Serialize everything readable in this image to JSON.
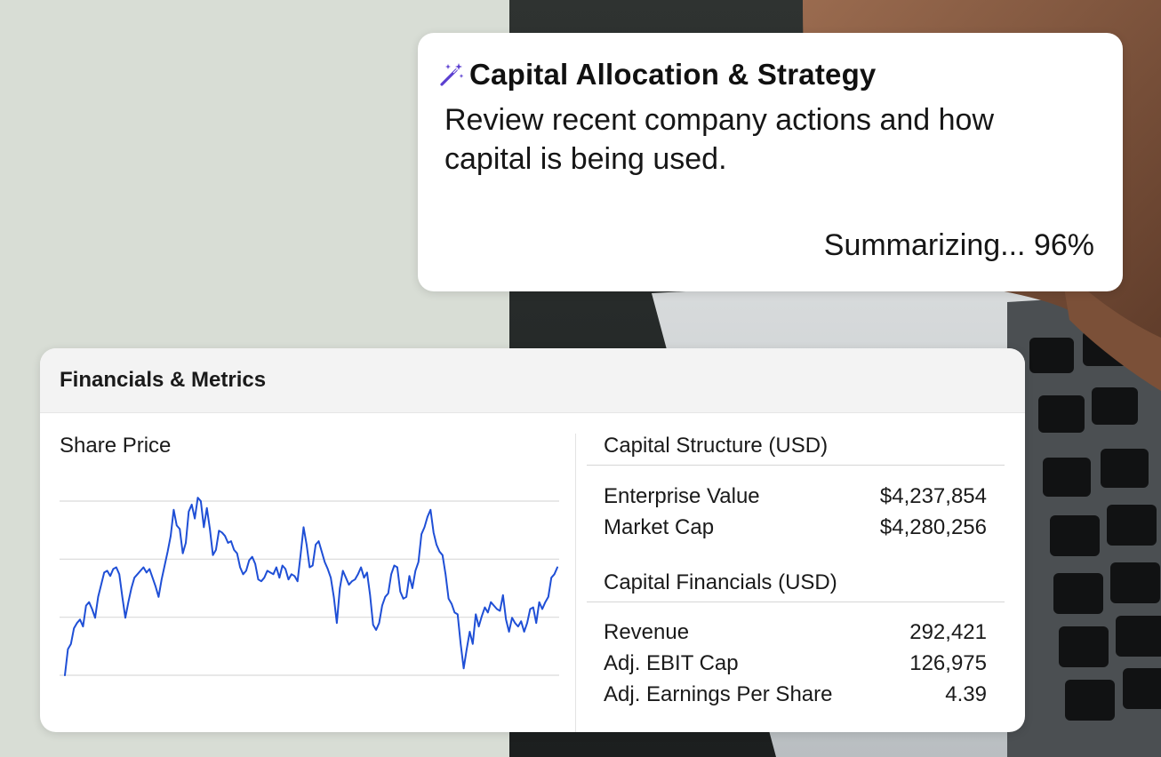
{
  "summary": {
    "icon": "magic-wand-icon",
    "title": "Capital Allocation & Strategy",
    "description": "Review recent company actions and how capital is being used.",
    "status": "Summarizing... 96%",
    "progress_percent": 96,
    "accent_color": "#5b3fd0"
  },
  "financials": {
    "header": "Financials & Metrics",
    "share_price": {
      "title": "Share Price"
    },
    "capital_structure": {
      "title": "Capital Structure (USD)",
      "rows": [
        {
          "label": "Enterprise Value",
          "value": "$4,237,854"
        },
        {
          "label": "Market Cap",
          "value": "$4,280,256"
        }
      ]
    },
    "capital_financials": {
      "title": "Capital Financials (USD)",
      "rows": [
        {
          "label": "Revenue",
          "value": "292,421"
        },
        {
          "label": "Adj. EBIT Cap",
          "value": "126,975"
        },
        {
          "label": "Adj. Earnings Per Share",
          "value": "4.39"
        }
      ]
    }
  },
  "chart_data": {
    "type": "line",
    "grid": true,
    "line_color": "#1f4fd6",
    "ylim": [
      0,
      100
    ],
    "series": [
      {
        "values": [
          0,
          15,
          18,
          27,
          30,
          32,
          28,
          40,
          42,
          38,
          33,
          45,
          52,
          59,
          60,
          57,
          61,
          62,
          58,
          45,
          33,
          42,
          50,
          56,
          58,
          60,
          62,
          59,
          61,
          56,
          51,
          45,
          55,
          63,
          71,
          80,
          95,
          86,
          84,
          70,
          76,
          94,
          98,
          90,
          102,
          100,
          85,
          96,
          84,
          69,
          72,
          83,
          82,
          80,
          76,
          77,
          72,
          70,
          62,
          58,
          60,
          66,
          68,
          64,
          55,
          54,
          56,
          60,
          59,
          58,
          62,
          56,
          63,
          61,
          55,
          58,
          57,
          54,
          69,
          85,
          75,
          62,
          63,
          75,
          77,
          71,
          65,
          61,
          56,
          45,
          30,
          50,
          60,
          56,
          52,
          54,
          55,
          58,
          62,
          56,
          59,
          46,
          29,
          26,
          30,
          40,
          45,
          47,
          58,
          63,
          62,
          48,
          44,
          45,
          57,
          50,
          60,
          65,
          81,
          85,
          91,
          95,
          82,
          75,
          71,
          69,
          58,
          44,
          41,
          36,
          35,
          18,
          4,
          15,
          25,
          18,
          35,
          28,
          34,
          39,
          36,
          42,
          40,
          38,
          37,
          46,
          32,
          25,
          33,
          30,
          28,
          31,
          25,
          30,
          38,
          39,
          30,
          42,
          38,
          42,
          45,
          56,
          58,
          62
        ]
      }
    ]
  }
}
